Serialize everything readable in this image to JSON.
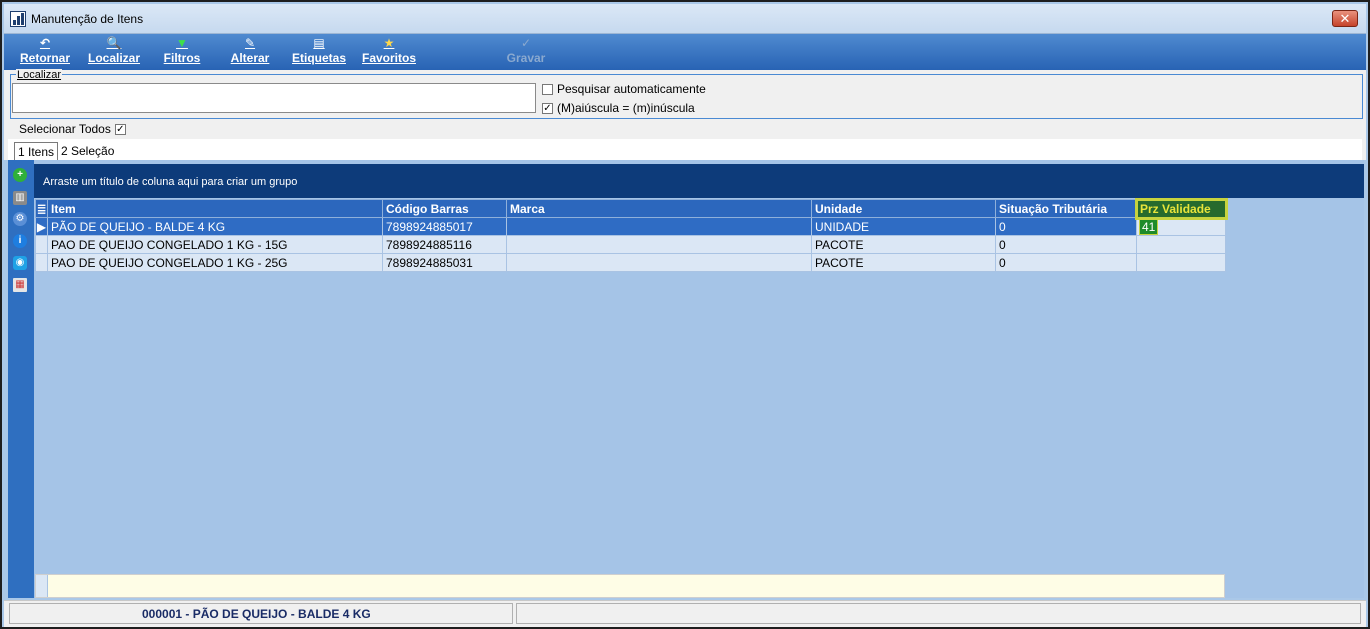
{
  "window": {
    "title": "Manutenção de Itens",
    "close": "✕"
  },
  "toolbar": [
    {
      "label": "Retornar",
      "icon": "↶",
      "enabled": true
    },
    {
      "label": "Localizar",
      "icon": "🔍",
      "enabled": true
    },
    {
      "label": "Filtros",
      "icon": "▼",
      "enabled": true
    },
    {
      "label": "Alterar",
      "icon": "✎",
      "enabled": true
    },
    {
      "label": "Etiquetas",
      "icon": "▤",
      "enabled": true
    },
    {
      "label": "Favoritos",
      "icon": "★",
      "enabled": true
    },
    {
      "label": "Gravar",
      "icon": "✓",
      "enabled": false
    }
  ],
  "search": {
    "group_label": "Localizar",
    "value": "",
    "auto_search_label": "Pesquisar automaticamente",
    "auto_search_checked": false,
    "case_label": "(M)aiúscula = (m)inúscula",
    "case_checked": true
  },
  "select_all": {
    "label": "Selecionar Todos",
    "checked": true
  },
  "tabs": [
    {
      "label": "1 Itens",
      "active": true
    },
    {
      "label": "2 Seleção",
      "active": false
    }
  ],
  "grid": {
    "group_hint": "Arraste um título de coluna aqui para criar um grupo",
    "columns": [
      "Item",
      "Código Barras",
      "Marca",
      "Unidade",
      "Situação Tributária",
      "Prz Validade"
    ],
    "rows": [
      [
        "PÃO DE QUEIJO - BALDE 4 KG",
        "7898924885017",
        "",
        "UNIDADE",
        "0",
        "41"
      ],
      [
        "PAO DE QUEIJO CONGELADO 1 KG - 15G",
        "7898924885116",
        "",
        "PACOTE",
        "0",
        ""
      ],
      [
        "PAO DE QUEIJO CONGELADO 1 KG - 25G",
        "7898924885031",
        "",
        "PACOTE",
        "0",
        ""
      ]
    ],
    "selected_row": 0,
    "editing_column": "Prz Validade"
  },
  "side_icons": [
    "add-icon",
    "trash-icon",
    "gear-icon",
    "info-icon",
    "camera-icon",
    "grid-export-icon"
  ],
  "status": {
    "current_item": "000001 - PÃO DE QUEIJO - BALDE 4 KG"
  },
  "colors": {
    "toolbar": "#2863b4",
    "header": "#2c67bd",
    "highlight": "#c7d33e",
    "group_bar": "#0d3b7a"
  }
}
